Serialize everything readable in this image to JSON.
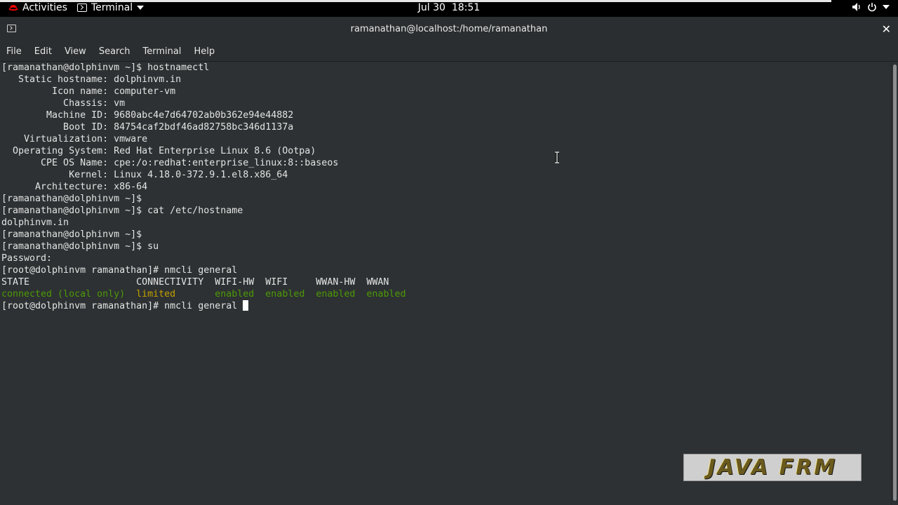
{
  "topbar": {
    "activities_label": "Activities",
    "app_menu_label": "Terminal",
    "clock": "Jul 30  18:51",
    "icons": [
      "redhat-logo-icon",
      "terminal-icon",
      "chevron-down-icon",
      "volume-icon",
      "power-icon",
      "chevron-down-icon"
    ]
  },
  "window": {
    "title": "ramanathan@localhost:/home/ramanathan"
  },
  "menubar": {
    "items": [
      "File",
      "Edit",
      "View",
      "Search",
      "Terminal",
      "Help"
    ]
  },
  "terminal": {
    "lines": [
      "[ramanathan@dolphinvm ~]$ hostnamectl",
      "   Static hostname: dolphinvm.in",
      "         Icon name: computer-vm",
      "           Chassis: vm",
      "        Machine ID: 9680abc4e7d64702ab0b362e94e44882",
      "           Boot ID: 84754caf2bdf46ad82758bc346d1137a",
      "    Virtualization: vmware",
      "  Operating System: Red Hat Enterprise Linux 8.6 (Ootpa)",
      "       CPE OS Name: cpe:/o:redhat:enterprise_linux:8::baseos",
      "            Kernel: Linux 4.18.0-372.9.1.el8.x86_64",
      "      Architecture: x86-64",
      "[ramanathan@dolphinvm ~]$",
      "[ramanathan@dolphinvm ~]$ cat /etc/hostname",
      "dolphinvm.in",
      "[ramanathan@dolphinvm ~]$",
      "[ramanathan@dolphinvm ~]$ su",
      "Password:",
      "[root@dolphinvm ramanathan]# nmcli general",
      "STATE                   CONNECTIVITY  WIFI-HW  WIFI     WWAN-HW  WWAN"
    ],
    "status_row": {
      "state": "connected (local only)",
      "connectivity": "limited",
      "wifi_hw": "enabled",
      "wifi": "enabled",
      "wwan_hw": "enabled",
      "wwan": "enabled"
    },
    "current_prompt": "[root@dolphinvm ramanathan]# nmcli general "
  },
  "colors": {
    "terminal_bg": "#2d3133",
    "terminal_fg": "#e4e4e4",
    "green": "#4e9a06",
    "yellow": "#c4a000",
    "chrome": "#2b2e30"
  },
  "watermark": {
    "text": "JAVA FRM"
  }
}
